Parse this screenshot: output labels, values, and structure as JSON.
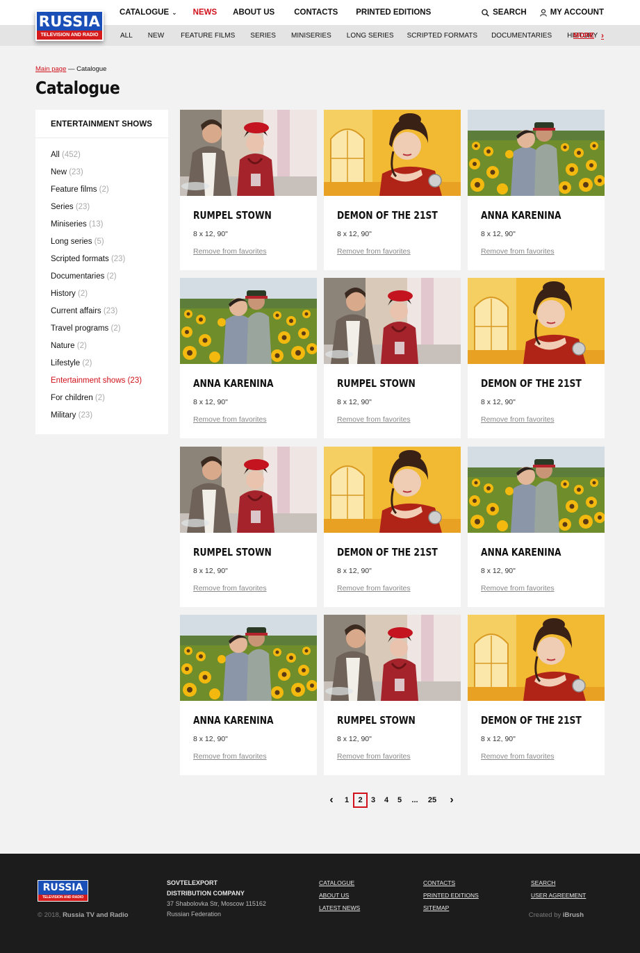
{
  "brand": {
    "title": "RUSSIA",
    "subtitle": "TELEVISION AND RADIO"
  },
  "header": {
    "nav": [
      {
        "label": "CATALOGUE",
        "active": false,
        "dropdown": true
      },
      {
        "label": "NEWS",
        "active": true
      },
      {
        "label": "ABOUT US",
        "active": false
      },
      {
        "label": "CONTACTS",
        "active": false
      },
      {
        "label": "PRINTED EDITIONS",
        "active": false
      }
    ],
    "search_label": "SEARCH",
    "account_label": "MY ACCOUNT",
    "subnav": [
      "ALL",
      "NEW",
      "FEATURE FILMS",
      "SERIES",
      "MINISERIES",
      "LONG SERIES",
      "SCRIPTED FORMATS",
      "DOCUMENTARIES",
      "HISTORY"
    ],
    "more_label": "MORE"
  },
  "breadcrumb": {
    "home": "Main page",
    "separator": "—",
    "current": "Catalogue"
  },
  "page_title": "Catalogue",
  "sidebar": {
    "heading": "ENTERTAINMENT SHOWS",
    "items": [
      {
        "label": "All",
        "count": "(452)"
      },
      {
        "label": "New",
        "count": "(23)"
      },
      {
        "label": "Feature films",
        "count": "(2)"
      },
      {
        "label": "Series",
        "count": "(23)"
      },
      {
        "label": "Miniseries",
        "count": "(13)"
      },
      {
        "label": "Long series",
        "count": "(5)"
      },
      {
        "label": "Scripted formats",
        "count": "(23)"
      },
      {
        "label": "Documentaries",
        "count": "(2)"
      },
      {
        "label": "History",
        "count": "(2)"
      },
      {
        "label": "Current affairs",
        "count": "(23)"
      },
      {
        "label": "Travel programs",
        "count": "(2)"
      },
      {
        "label": "Nature",
        "count": "(2)"
      },
      {
        "label": "Lifestyle",
        "count": "(2)"
      },
      {
        "label": "Entertainment shows",
        "count": "(23)",
        "active": true
      },
      {
        "label": "For children",
        "count": "(2)"
      },
      {
        "label": "Military",
        "count": "(23)"
      }
    ]
  },
  "cards": [
    {
      "title": "RUMPEL STOWN",
      "meta": "8 x 12, 90\"",
      "action": "Remove from favorites",
      "image": "couple-cafe"
    },
    {
      "title": "DEMON OF THE 21ST",
      "meta": "8 x 12, 90\"",
      "action": "Remove from favorites",
      "image": "woman-palace"
    },
    {
      "title": "ANNA KARENINA",
      "meta": "8 x 12, 90\"",
      "action": "Remove from favorites",
      "image": "sunflower-field"
    },
    {
      "title": "ANNA KARENINA",
      "meta": "8 x 12, 90\"",
      "action": "Remove from favorites",
      "image": "sunflower-field"
    },
    {
      "title": "RUMPEL STOWN",
      "meta": "8 x 12, 90\"",
      "action": "Remove from favorites",
      "image": "couple-cafe"
    },
    {
      "title": "DEMON OF THE 21ST",
      "meta": "8 x 12, 90\"",
      "action": "Remove from favorites",
      "image": "woman-palace"
    },
    {
      "title": "RUMPEL STOWN",
      "meta": "8 x 12, 90\"",
      "action": "Remove from favorites",
      "image": "couple-cafe"
    },
    {
      "title": "DEMON OF THE 21ST",
      "meta": "8 x 12, 90\"",
      "action": "Remove from favorites",
      "image": "woman-palace"
    },
    {
      "title": "ANNA KARENINA",
      "meta": "8 x 12, 90\"",
      "action": "Remove from favorites",
      "image": "sunflower-field"
    },
    {
      "title": "ANNA KARENINA",
      "meta": "8 x 12, 90\"",
      "action": "Remove from favorites",
      "image": "sunflower-field"
    },
    {
      "title": "RUMPEL STOWN",
      "meta": "8 x 12, 90\"",
      "action": "Remove from favorites",
      "image": "couple-cafe"
    },
    {
      "title": "DEMON OF THE 21ST",
      "meta": "8 x 12, 90\"",
      "action": "Remove from favorites",
      "image": "woman-palace"
    }
  ],
  "pagination": {
    "prev": "‹",
    "pages": [
      "1",
      "2",
      "3",
      "4",
      "5",
      "...",
      "25"
    ],
    "current": "2",
    "next": "›"
  },
  "footer": {
    "company_name_1": "SOVTELEXPORT",
    "company_name_2": "DISTRIBUTION COMPANY",
    "address_1": "37 Shabolovka Str, Moscow 115162",
    "address_2": "Russian Federation",
    "copyright_prefix": "© 2018,",
    "copyright_name": "Russia TV and Radio",
    "col1": [
      "CATALOGUE",
      "ABOUT US",
      "LATEST NEWS"
    ],
    "col2": [
      "CONTACTS",
      "PRINTED EDITIONS",
      "SITEMAP"
    ],
    "col3": [
      "SEARCH",
      "USER AGREEMENT"
    ],
    "credit_prefix": "Created by",
    "credit_name": "iBrush"
  },
  "colors": {
    "accent": "#d0101a",
    "brand_blue": "#1a4fb8",
    "footer_bg": "#1c1c1c"
  }
}
